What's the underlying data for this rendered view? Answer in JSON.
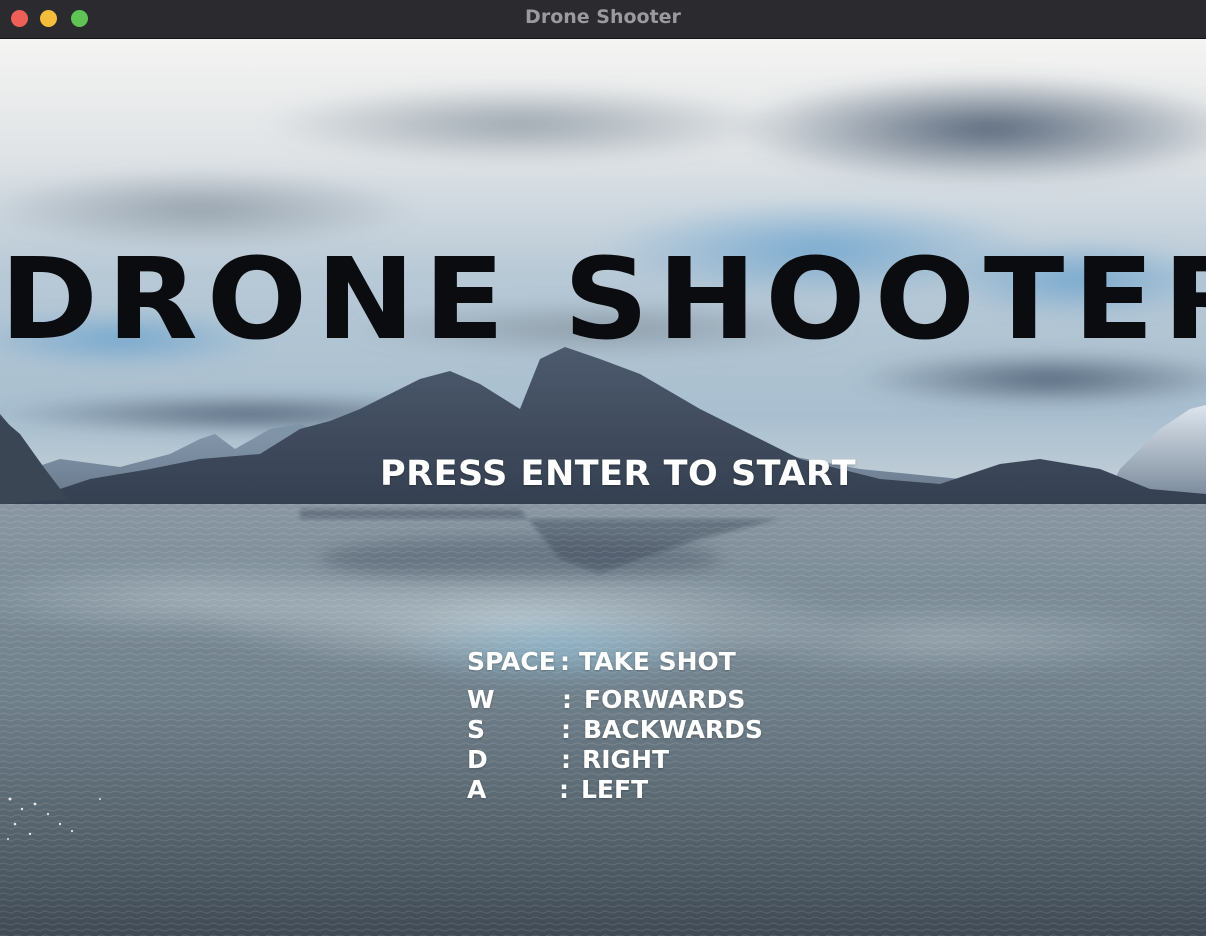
{
  "window": {
    "title": "Drone Shooter"
  },
  "game": {
    "title": "DRONE SHOOTER",
    "prompt": "PRESS ENTER TO START"
  },
  "controls": [
    {
      "key": "SPACE",
      "separator": ":",
      "action": "TAKE SHOT"
    },
    {
      "key": "W",
      "separator": ":",
      "action": "FORWARDS"
    },
    {
      "key": "S",
      "separator": ":",
      "action": "BACKWARDS"
    },
    {
      "key": "D",
      "separator": ":",
      "action": "RIGHT"
    },
    {
      "key": "A",
      "separator": ":",
      "action": "LEFT"
    }
  ],
  "colors": {
    "titlebar": "#2b2a2f",
    "close": "#ee5f57",
    "minimize": "#f4bd3b",
    "maximize": "#5fc454",
    "title_text": "#0b0c10",
    "overlay_text": "#ffffff"
  }
}
